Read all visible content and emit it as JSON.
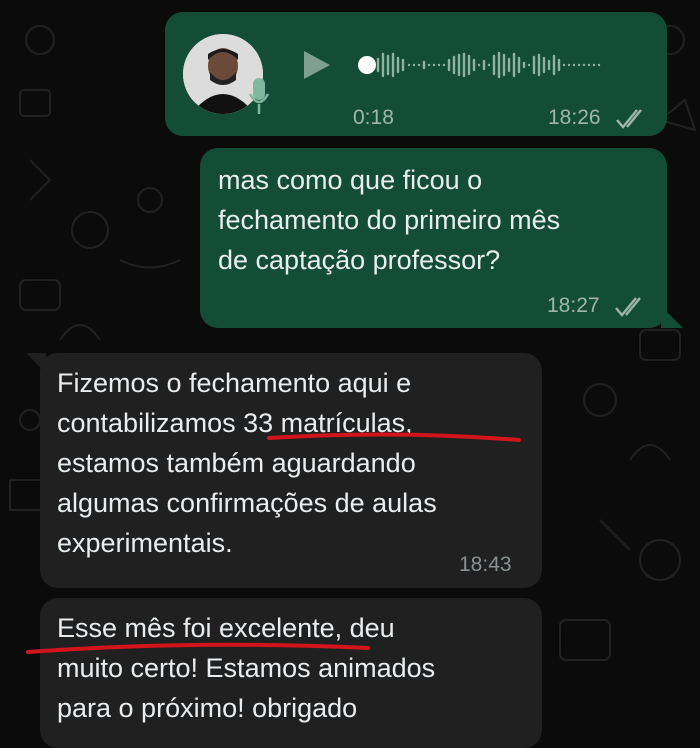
{
  "chat": {
    "voice_message": {
      "duration": "0:18",
      "time": "18:26",
      "played_fraction": 0.0,
      "status_icon": "double-check-icon",
      "sender_icon": "mic-icon"
    },
    "outgoing_text": {
      "text": "mas como que ficou o\nfechamento do primeiro mês\nde captação professor?",
      "time": "18:27",
      "status_icon": "double-check-icon"
    },
    "incoming_1": {
      "text": "Fizemos o fechamento aqui e\ncontabilizamos 33 matrículas,\nestamos também aguardando\nalgumas confirmações de aulas\nexperimentais.",
      "time": "18:43"
    },
    "incoming_2": {
      "text": "Esse mês foi excelente, deu\nmuito certo! Estamos animados\npara o próximo! obrigado"
    }
  },
  "colors": {
    "background": "#0b0b0b",
    "outgoing_bubble": "#144d37",
    "incoming_bubble": "#202020",
    "annotation_underline": "#d3141c"
  }
}
